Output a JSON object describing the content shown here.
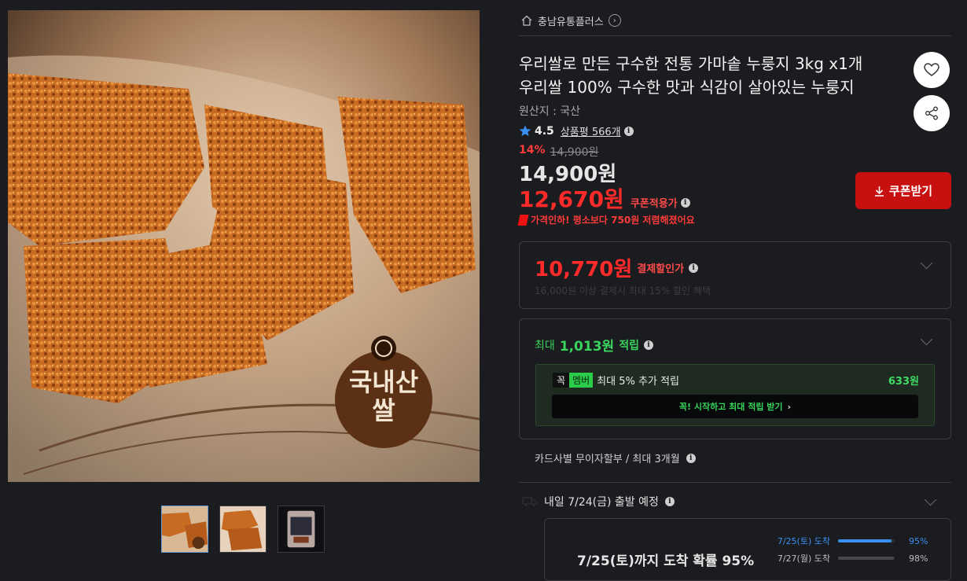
{
  "breadcrumb": {
    "seller": "충남유통플러스"
  },
  "product": {
    "title_line1": "우리쌀로 만든 구수한 전통 가마솥 누룽지 3kg x1개",
    "title_line2": "우리쌀 100% 구수한 맛과 식감이 살아있는 누룽지",
    "origin": "원산지 : 국산",
    "rating": "4.5",
    "reviews_label": "상품평",
    "reviews_count": "566개",
    "image_badge_line1": "국내산",
    "image_badge_line2": "쌀"
  },
  "pricing": {
    "discount_pct": "14%",
    "original_price": "14,900원",
    "sale_price": "14,900원",
    "coupon_price": "12,670원",
    "coupon_price_label": "쿠폰적용가",
    "price_drop_note": "가격인하! 평소보다 750원 저렴해졌어요",
    "coupon_button": "쿠폰받기"
  },
  "payment": {
    "price": "10,770원",
    "label": "결제할인가",
    "sub_text": "16,000원 이상 결제시 최대 15% 할인 혜택"
  },
  "reward": {
    "prefix": "최대",
    "amount": "1,013원",
    "suffix": "적립",
    "member_tag1": "꼭",
    "member_tag2": "멤버",
    "member_text": "최대 5% 추가 적립",
    "member_points": "633원",
    "member_button": "꼭! 시작하고 최대 적립 받기"
  },
  "installment": {
    "text": "카드사별 무이자할부 / 최대 3개월"
  },
  "delivery": {
    "departure": "내일 7/24(금) 출발 예정",
    "arrival_summary": "7/25(토)까지 도착 확률 95%",
    "probabilities": [
      {
        "date": "7/25(토) 도착",
        "percent": "95%",
        "fill": 0.95
      },
      {
        "date": "7/27(월) 도착",
        "percent": "98%",
        "fill": 0.98
      }
    ]
  },
  "icons": {
    "home": "home-icon",
    "wish": "heart-icon",
    "share": "share-icon",
    "star": "star-icon",
    "info": "info-icon",
    "download": "download-icon"
  },
  "colors": {
    "background": "#1b1c1f",
    "price_red": "#ff2a2a",
    "coupon_button": "#c81010",
    "reward_green": "#39d45d",
    "delivery_blue": "#3a8ff3"
  }
}
